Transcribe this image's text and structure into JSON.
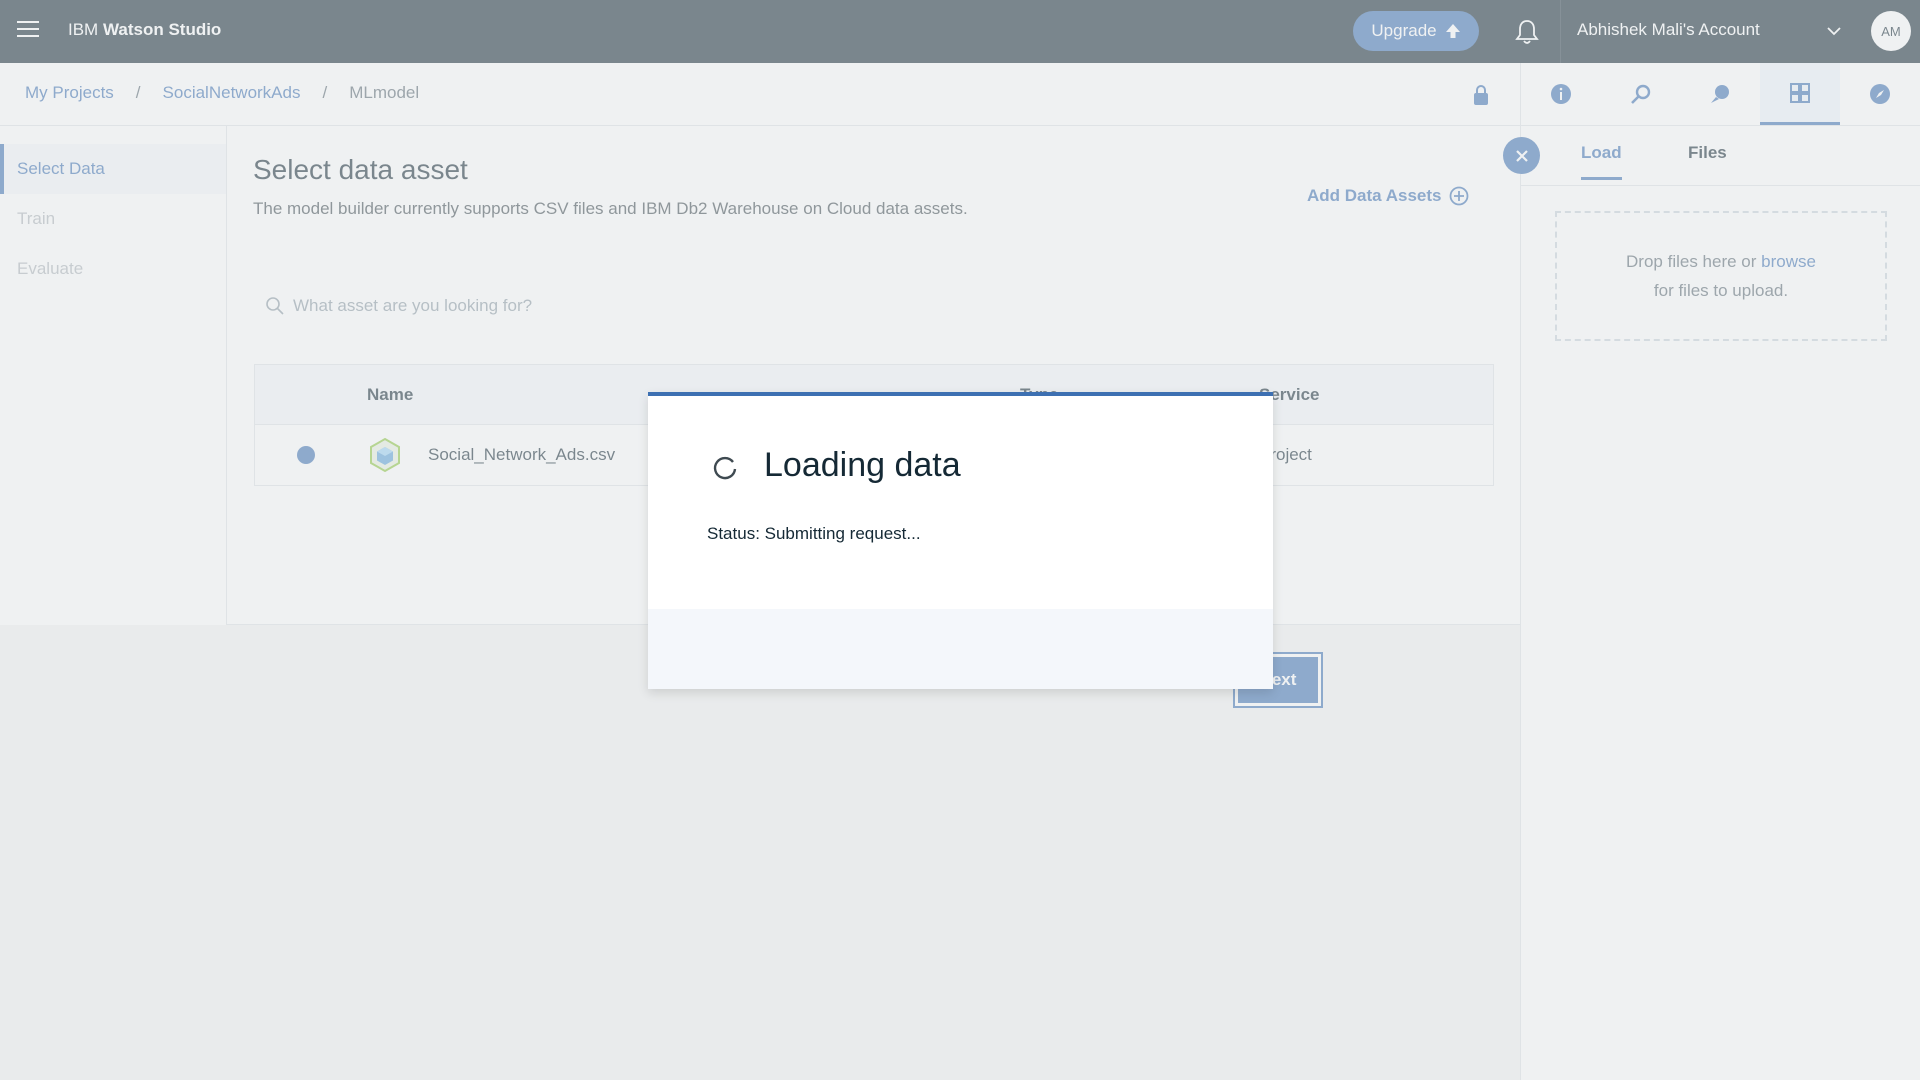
{
  "topbar": {
    "brand_prefix": "IBM",
    "brand_name": "Watson Studio",
    "upgrade_label": "Upgrade",
    "account_name": "Abhishek Mali's Account",
    "avatar_initials": "AM"
  },
  "breadcrumb": {
    "items": [
      "My Projects",
      "SocialNetworkAds"
    ],
    "current": "MLmodel",
    "separator": "/"
  },
  "leftnav": {
    "items": [
      {
        "label": "Select Data"
      },
      {
        "label": "Train"
      },
      {
        "label": "Evaluate"
      }
    ]
  },
  "main": {
    "title": "Select data asset",
    "description": "The model builder currently supports CSV files and IBM Db2 Warehouse on Cloud data assets.",
    "add_assets_label": "Add Data Assets",
    "search_placeholder": "What asset are you looking for?",
    "table": {
      "headers": {
        "name": "Name",
        "type": "Type",
        "service": "Service"
      },
      "rows": [
        {
          "name": "Social_Network_Ads.csv",
          "type": "",
          "service": "Project"
        }
      ]
    },
    "next_label": "Next"
  },
  "rightpanel": {
    "tabs": [
      "Load",
      "Files"
    ],
    "drop_text": "Drop files here or",
    "browse_text": "browse",
    "drop_text_2": "for files to upload."
  },
  "modal": {
    "title": "Loading data",
    "status": "Status: Submitting request..."
  },
  "colors": {
    "accent": "#3d70b2",
    "topbar": "#152935",
    "text": "#152935"
  },
  "icons": [
    "menu-icon",
    "upload-arrow-icon",
    "bell-icon",
    "chevron-down-icon",
    "lock-icon",
    "info-icon",
    "search-icon",
    "add-circle-icon",
    "close-icon",
    "spinner-icon",
    "data-asset-icon"
  ]
}
